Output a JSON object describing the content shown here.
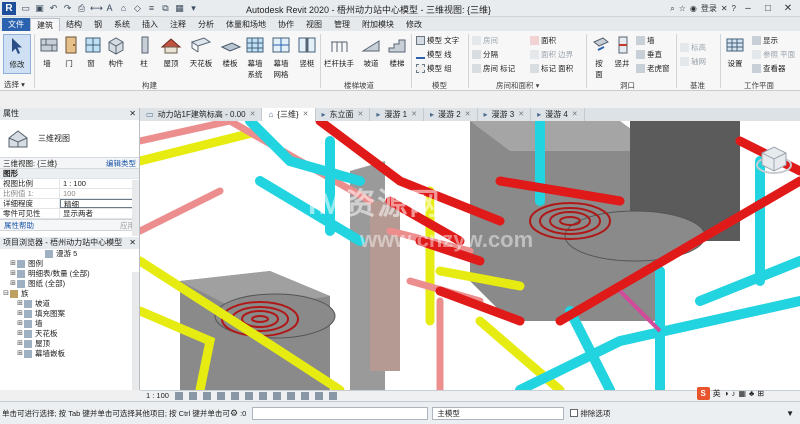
{
  "app": {
    "logo_letter": "R",
    "window_title": "Autodesk Revit 2020 - 梧州动力站中心模型 - 三维视图: {三维}",
    "sign_in": "登录",
    "help": "?"
  },
  "ribbon_tabs": [
    "文件",
    "建筑",
    "结构",
    "钢",
    "系统",
    "插入",
    "注释",
    "分析",
    "体量和场地",
    "协作",
    "视图",
    "管理",
    "附加模块",
    "修改"
  ],
  "ribbon": {
    "modify": "修改",
    "select": "选择 ▾",
    "buttons": [
      "墙",
      "门",
      "窗",
      "构件",
      "柱",
      "屋顶",
      "天花板",
      "楼板",
      "幕墙\n系统",
      "幕墙\n网格",
      "竖梃",
      "栏杆扶手",
      "坡道",
      "楼梯"
    ],
    "model_small": [
      "模型 文字",
      "模型 线",
      "模型 组"
    ],
    "room_small": [
      "房间",
      "分隔",
      "面积",
      "房间 标记",
      "面积 边界",
      "标记 面积"
    ],
    "opening_buttons": [
      "按\n面",
      "竖井",
      "墙",
      "垂直",
      "老虎窗"
    ],
    "datum": [
      "标高",
      "轴网"
    ],
    "workplane": [
      "设置",
      "显示",
      "参照 平面",
      "查看器"
    ],
    "groups": [
      "构建",
      "楼梯坡道",
      "模型",
      "房间和面积 ▾",
      "洞口",
      "基准",
      "工作平面"
    ]
  },
  "view_tabs": [
    {
      "label": "动力站1F建筑标高 - 0.00",
      "active": false
    },
    {
      "label": "{三维}",
      "active": true
    },
    {
      "label": "东立面",
      "active": false
    },
    {
      "label": "漫游 1",
      "active": false
    },
    {
      "label": "漫游 2",
      "active": false
    },
    {
      "label": "漫游 3",
      "active": false
    },
    {
      "label": "漫游 4",
      "active": false
    }
  ],
  "properties": {
    "title": "属性",
    "type_name": "三维视图",
    "selector": "三维视图: {三维}",
    "edit_type": "编辑类型",
    "section": "图形",
    "rows": [
      {
        "k": "视图比例",
        "v": "1 : 100",
        "dim": false,
        "boxed": false
      },
      {
        "k": "比例值 1:",
        "v": "100",
        "dim": true,
        "boxed": false
      },
      {
        "k": "详细程度",
        "v": "精细",
        "dim": false,
        "boxed": true
      },
      {
        "k": "零件可见性",
        "v": "显示两者",
        "dim": false,
        "boxed": false
      }
    ],
    "help_link": "属性帮助",
    "apply": "应用"
  },
  "browser": {
    "title": "项目浏览器 - 梧州动力站中心模型",
    "items": [
      {
        "label": "漫游 5",
        "indent": 5,
        "toggle": ""
      },
      {
        "label": "图例",
        "indent": 1,
        "toggle": "⊞"
      },
      {
        "label": "明细表/数量 (全部)",
        "indent": 1,
        "toggle": "⊞"
      },
      {
        "label": "图纸 (全部)",
        "indent": 1,
        "toggle": "⊞"
      },
      {
        "label": "族",
        "indent": 0,
        "toggle": "⊟"
      },
      {
        "label": "坡道",
        "indent": 2,
        "toggle": "⊞"
      },
      {
        "label": "填充图案",
        "indent": 2,
        "toggle": "⊞"
      },
      {
        "label": "墙",
        "indent": 2,
        "toggle": "⊞"
      },
      {
        "label": "天花板",
        "indent": 2,
        "toggle": "⊞"
      },
      {
        "label": "屋顶",
        "indent": 2,
        "toggle": "⊞"
      },
      {
        "label": "幕墙嵌板",
        "indent": 2,
        "toggle": "⊞"
      }
    ]
  },
  "watermark": {
    "line1": "IM资源网",
    "line2": "www.cnzyw.com"
  },
  "view_bar": {
    "scale": "1 : 100"
  },
  "status": {
    "message": "单击可进行选择; 按 Tab 键并单击可选择其他项目; 按 Ctrl 键并单击可将...",
    "model_selector": "主模型",
    "exclude_options": "排除选项",
    "coord": ":0"
  },
  "ime": {
    "logo": "S",
    "lang": "英"
  },
  "colors": {
    "file_tab": "#2a62b0",
    "pipe_red": "#e01919",
    "pipe_cyan": "#22d3e0",
    "pipe_yellow": "#e6ec12",
    "pipe_pink": "#ec8e8e",
    "equipment_gray": "#8e8e8e"
  }
}
